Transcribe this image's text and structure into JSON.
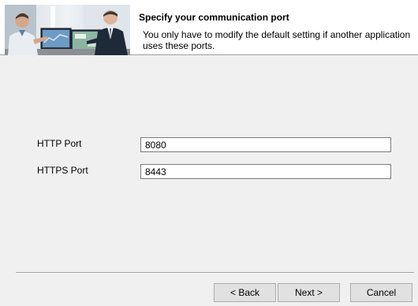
{
  "header": {
    "title": "Specify your communication port",
    "description": "You only have to modify the default setting if another application uses these ports."
  },
  "fields": {
    "http": {
      "label": "HTTP Port",
      "value": "8080"
    },
    "https": {
      "label": "HTTPS Port",
      "value": "8443"
    }
  },
  "buttons": {
    "back": "< Back",
    "next": "Next >",
    "cancel": "Cancel"
  },
  "icons": {
    "banner": "office-workers-photo"
  },
  "colors": {
    "window_bg": "#f0f0f0",
    "header_bg": "#ffffff",
    "button_bg": "#e1e1e1",
    "input_border": "#7a7a7a"
  }
}
